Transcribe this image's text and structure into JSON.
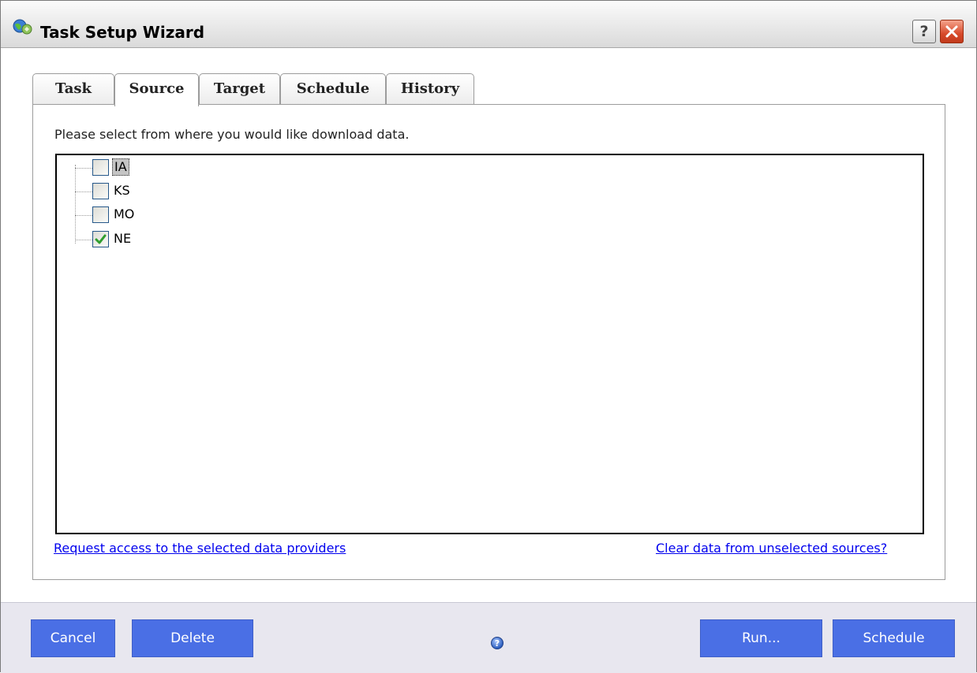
{
  "window": {
    "title": "Task Setup Wizard",
    "help_label": "?"
  },
  "tabs": [
    {
      "label": "Task"
    },
    {
      "label": "Source",
      "active": true
    },
    {
      "label": "Target"
    },
    {
      "label": "Schedule"
    },
    {
      "label": "History"
    }
  ],
  "source": {
    "prompt": "Please select from where you would like download data.",
    "items": [
      {
        "label": "IA",
        "checked": false,
        "focused": true
      },
      {
        "label": "KS",
        "checked": false
      },
      {
        "label": "MO",
        "checked": false
      },
      {
        "label": "NE",
        "checked": true
      }
    ],
    "request_access_link": "Request access to the selected data providers",
    "clear_data_link": "Clear data from unselected sources?"
  },
  "footer": {
    "cancel_label": "Cancel",
    "delete_label": "Delete",
    "help_icon_glyph": "?",
    "run_label": "Run...",
    "schedule_label": "Schedule"
  },
  "colors": {
    "button_blue": "#4a6fe5",
    "close_red": "#d84a2a",
    "check_green": "#2f9e2f",
    "link_blue": "#0000ee"
  }
}
